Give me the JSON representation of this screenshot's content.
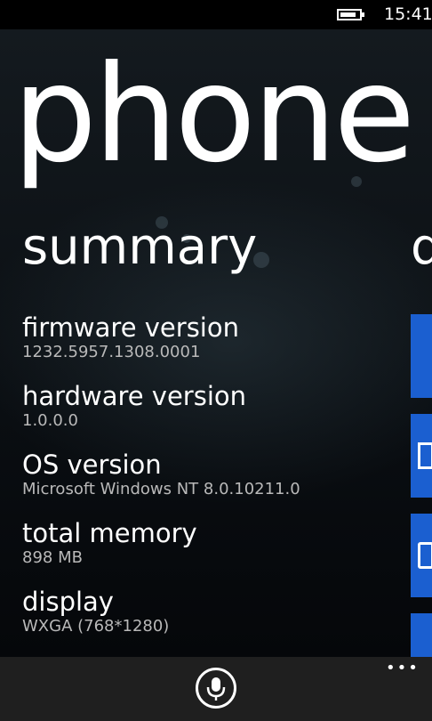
{
  "status_bar": {
    "battery_icon": "battery-icon",
    "time": "15:41"
  },
  "panorama": {
    "title": "phone",
    "section_title": "summary",
    "next_section_peek": "d",
    "items": [
      {
        "label": "firmware version",
        "value": "1232.5957.1308.0001"
      },
      {
        "label": "hardware version",
        "value": "1.0.0.0"
      },
      {
        "label": "OS version",
        "value": "Microsoft Windows NT 8.0.10211.0"
      },
      {
        "label": "total memory",
        "value": "898 MB"
      },
      {
        "label": "display",
        "value": "WXGA (768*1280)"
      }
    ],
    "tile_color": "#1b5fd0"
  },
  "app_bar": {
    "mic_icon": "microphone-icon",
    "more_label": "•••"
  }
}
